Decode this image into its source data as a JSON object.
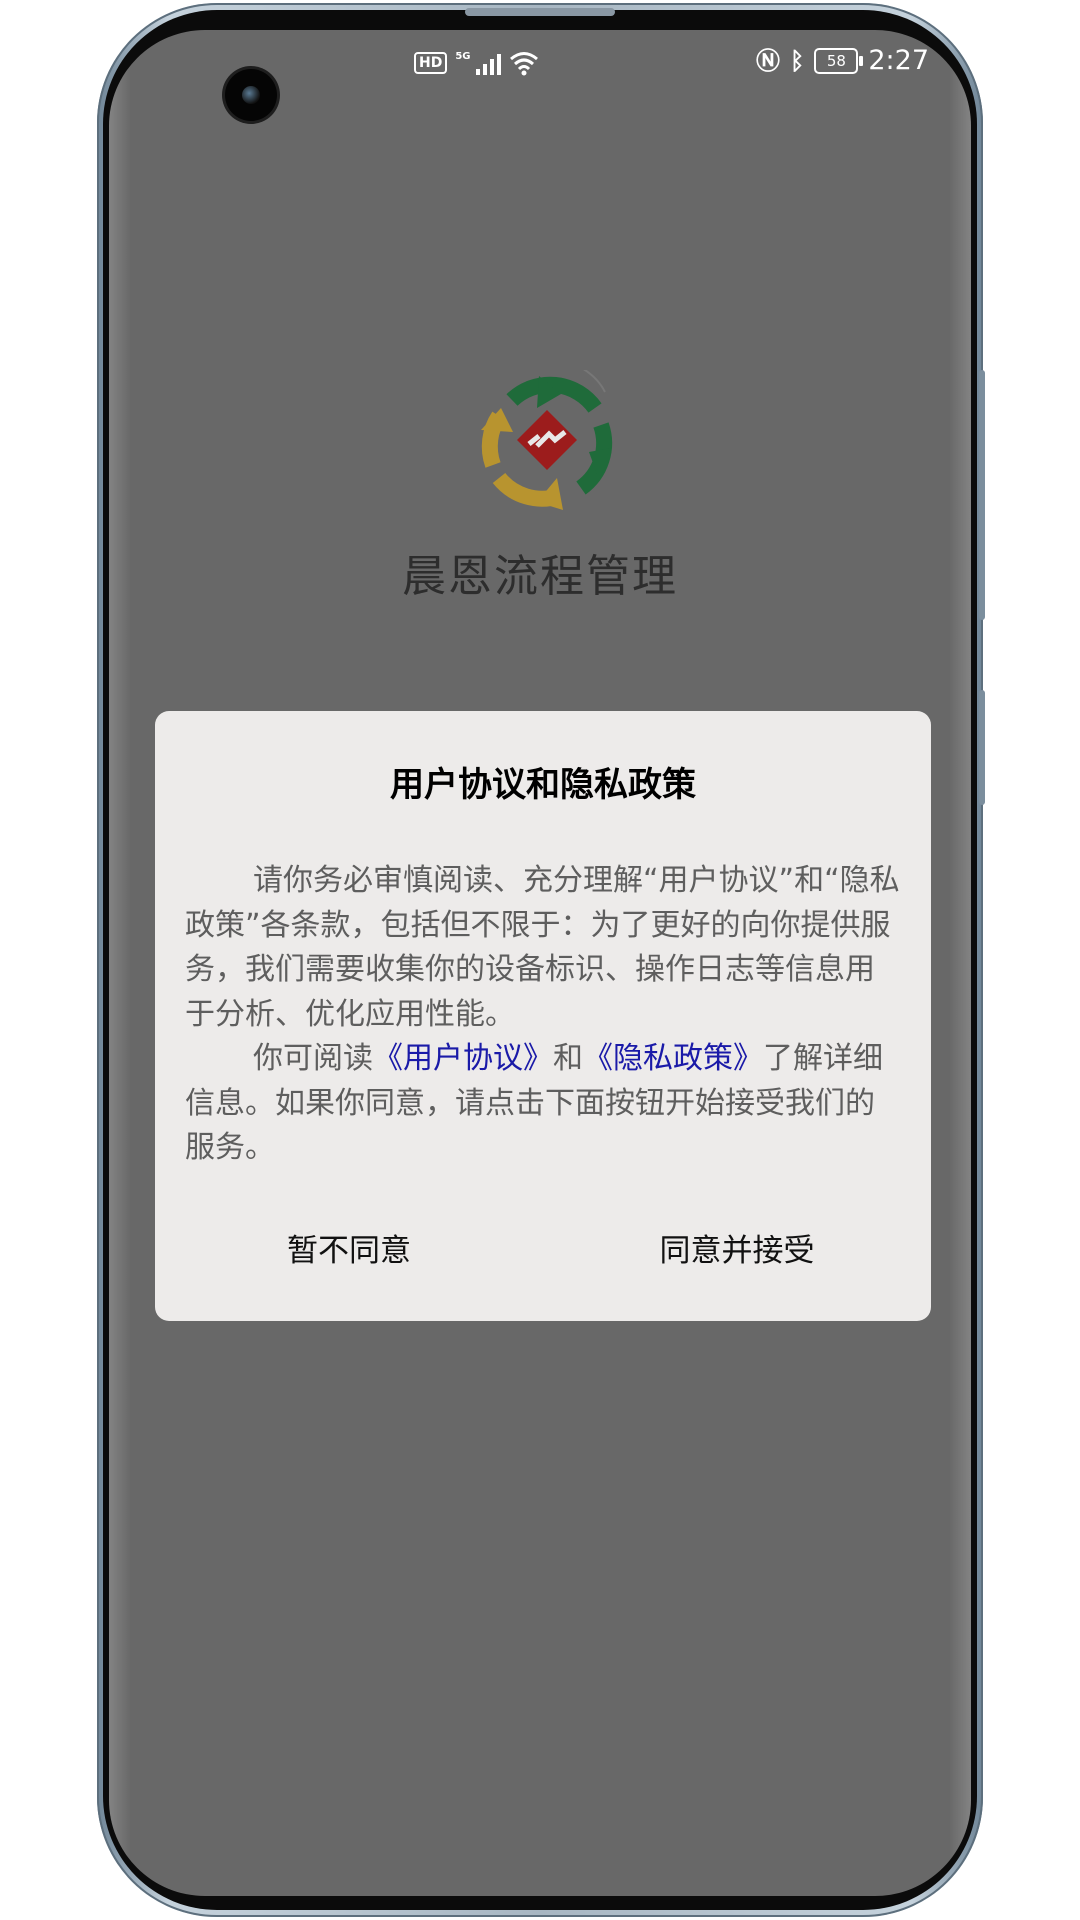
{
  "status_bar": {
    "hd_label": "HD",
    "network_label": "5G",
    "battery_level": "58",
    "time": "2:27"
  },
  "app": {
    "name": "晨恩流程管理",
    "logo_colors": {
      "green": "#1f6b3a",
      "gold": "#b8942f",
      "red": "#9c1c1c"
    }
  },
  "dialog": {
    "title": "用户协议和隐私政策",
    "paragraph1": "请你务必审慎阅读、充分理解“用户协议”和“隐私政策”各条款，包括但不限于：为了更好的向你提供服务，我们需要收集你的设备标识、操作日志等信息用于分析、优化应用性能。",
    "paragraph2_prefix": "你可阅读",
    "user_agreement_link": "《用户协议》",
    "conjunction": "和",
    "privacy_policy_link": "《隐私政策》",
    "paragraph2_suffix": "了解详细信息。如果你同意，请点击下面按钮开始接受我们的服务。",
    "decline_label": "暂不同意",
    "accept_label": "同意并接受"
  },
  "colors": {
    "overlay_background": "#686868",
    "dialog_background": "#edebea",
    "link": "#1a1aa8"
  }
}
